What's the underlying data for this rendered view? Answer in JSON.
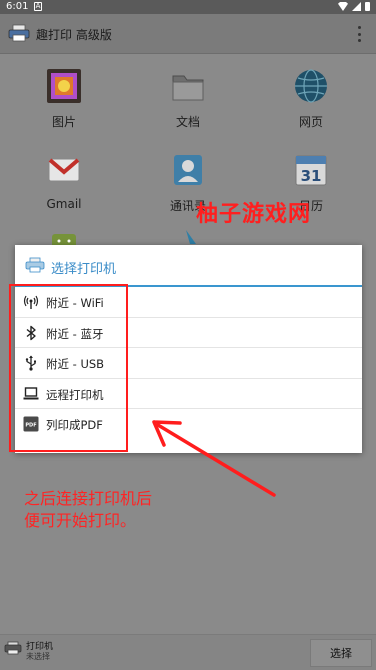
{
  "status_bar": {
    "time": "6:01",
    "notification_glyph": "A"
  },
  "action_bar": {
    "title": "趣打印 高级版",
    "overflow_menu_icon": "overflow-menu-icon"
  },
  "grid": {
    "items": [
      {
        "label": "图片",
        "icon": "pictures-icon"
      },
      {
        "label": "文档",
        "icon": "folder-icon"
      },
      {
        "label": "网页",
        "icon": "globe-icon"
      },
      {
        "label": "Gmail",
        "icon": "gmail-icon"
      },
      {
        "label": "通讯录",
        "icon": "contacts-icon"
      },
      {
        "label": "日历",
        "icon": "calendar-icon"
      },
      {
        "label": "",
        "icon": "android-icon"
      },
      {
        "label": "",
        "icon": "drive-icon"
      }
    ],
    "calendar_day": "31"
  },
  "watermark": "柚子游戏网",
  "dialog": {
    "title": "选择打印机",
    "options": [
      {
        "label": "附近 - WiFi",
        "icon": "wifi-icon"
      },
      {
        "label": "附近 - 蓝牙",
        "icon": "bluetooth-icon"
      },
      {
        "label": "附近 - USB",
        "icon": "usb-icon"
      },
      {
        "label": "远程打印机",
        "icon": "laptop-icon"
      },
      {
        "label": "列印成PDF",
        "icon": "pdf-icon"
      }
    ],
    "pdf_badge": "PDF"
  },
  "annotation": {
    "line1": "之后连接打印机后",
    "line2": "便可开始打印。"
  },
  "bottom_bar": {
    "printer_label": "打印机",
    "printer_status": "未选择",
    "select_button": "选择"
  },
  "colors": {
    "accent": "#3a96cf",
    "annotation_red": "#ff1d1d"
  }
}
